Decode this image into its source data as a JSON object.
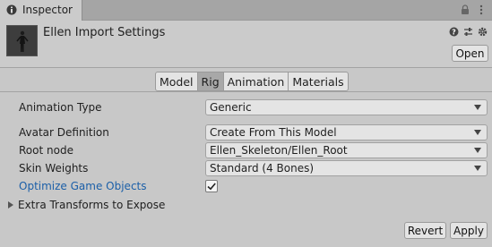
{
  "window": {
    "tab_title": "Inspector",
    "tab_icon": "info-icon",
    "tab_actions": [
      "lock-icon",
      "menu-dots-icon"
    ]
  },
  "header": {
    "title": "Ellen Import Settings",
    "icons": [
      "help-icon",
      "preset-sliders-icon",
      "gear-icon"
    ],
    "open_label": "Open"
  },
  "tabs": [
    {
      "label": "Model",
      "active": false
    },
    {
      "label": "Rig",
      "active": true
    },
    {
      "label": "Animation",
      "active": false
    },
    {
      "label": "Materials",
      "active": false
    }
  ],
  "rig": {
    "animation_type": {
      "label": "Animation Type",
      "value": "Generic"
    },
    "avatar_definition": {
      "label": "Avatar Definition",
      "value": "Create From This Model"
    },
    "root_node": {
      "label": "Root node",
      "value": "Ellen_Skeleton/Ellen_Root"
    },
    "skin_weights": {
      "label": "Skin Weights",
      "value": "Standard (4 Bones)"
    },
    "optimize_game_objects": {
      "label": "Optimize Game Objects",
      "checked": true
    },
    "extra_transforms": {
      "label": "Extra Transforms to Expose",
      "expanded": false
    }
  },
  "footer": {
    "revert_label": "Revert",
    "apply_label": "Apply"
  }
}
